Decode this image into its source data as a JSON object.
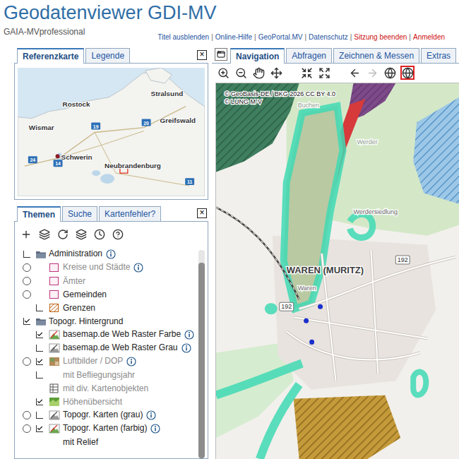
{
  "header": {
    "title": "Geodatenviewer GDI-MV",
    "subtitle": "GAIA-MVprofessional",
    "separator": "|",
    "links": [
      {
        "label": "Titel ausblenden",
        "alert": false
      },
      {
        "label": "Online-Hilfe",
        "alert": false
      },
      {
        "label": "GeoPortal.MV",
        "alert": false
      },
      {
        "label": "Datenschutz",
        "alert": false
      },
      {
        "label": "Sitzung beenden",
        "alert": true
      },
      {
        "label": "Anmelden",
        "alert": true
      }
    ]
  },
  "reference_panel": {
    "tabs": [
      {
        "label": "Referenzkarte",
        "selected": true
      },
      {
        "label": "Legende",
        "selected": false
      }
    ],
    "close": "×",
    "places": [
      {
        "name": "Stralsund",
        "kind": "city"
      },
      {
        "name": "Rostock",
        "kind": "city"
      },
      {
        "name": "Greifswald",
        "kind": "city"
      },
      {
        "name": "Wismar",
        "kind": "city"
      },
      {
        "name": "Schwerin",
        "kind": "capital"
      },
      {
        "name": "Neubrandenburg",
        "kind": "city"
      },
      {
        "name": "19",
        "kind": "road"
      },
      {
        "name": "20",
        "kind": "road"
      },
      {
        "name": "24",
        "kind": "road"
      },
      {
        "name": "14",
        "kind": "road"
      },
      {
        "name": "11",
        "kind": "road"
      }
    ]
  },
  "themes_panel": {
    "tabs": [
      {
        "label": "Themen",
        "selected": true
      },
      {
        "label": "Suche",
        "selected": false
      },
      {
        "label": "Kartenfehler?",
        "selected": false
      }
    ],
    "close": "×",
    "layers": [
      {
        "label": "Administration",
        "kind": "folder",
        "radio": false,
        "selected": false,
        "checkbox": true,
        "checked": false,
        "muted": false,
        "info": true
      },
      {
        "label": "Kreise und Städte",
        "kind": "polygon",
        "radio": true,
        "selected": false,
        "checkbox": false,
        "checked": false,
        "muted": true,
        "info": true
      },
      {
        "label": "Ämter",
        "kind": "polygon",
        "radio": true,
        "selected": false,
        "checkbox": false,
        "checked": false,
        "muted": true,
        "info": false
      },
      {
        "label": "Gemeinden",
        "kind": "polygon",
        "radio": true,
        "selected": false,
        "checkbox": false,
        "checked": false,
        "muted": false,
        "info": false
      },
      {
        "label": "Grenzen",
        "kind": "hatch",
        "radio": false,
        "selected": false,
        "checkbox": true,
        "checked": false,
        "muted": false,
        "info": false
      },
      {
        "label": "Topogr. Hintergrund",
        "kind": "folder",
        "radio": false,
        "selected": false,
        "checkbox": true,
        "checked": true,
        "muted": false,
        "info": false
      },
      {
        "label": "basemap.de Web Raster Farbe",
        "kind": "raster",
        "radio": false,
        "selected": false,
        "checkbox": true,
        "checked": true,
        "muted": false,
        "info": true
      },
      {
        "label": "basemap.de Web Raster Grau",
        "kind": "raster-grey",
        "radio": false,
        "selected": false,
        "checkbox": true,
        "checked": false,
        "muted": false,
        "info": true
      },
      {
        "label": "Luftbilder / DOP",
        "kind": "photo",
        "radio": true,
        "selected": false,
        "checkbox": true,
        "checked": true,
        "muted": true,
        "info": true
      },
      {
        "label": "mit Befliegungsjahr",
        "kind": "option",
        "radio": false,
        "selected": false,
        "checkbox": true,
        "checked": false,
        "muted": true,
        "info": false
      },
      {
        "label": "mit div. Kartenobjekten",
        "kind": "table",
        "radio": false,
        "selected": false,
        "checkbox": false,
        "checked": false,
        "muted": true,
        "info": false
      },
      {
        "label": "Höhenübersicht",
        "kind": "elevation",
        "radio": false,
        "selected": false,
        "checkbox": true,
        "checked": true,
        "muted": true,
        "info": false
      },
      {
        "label": "Topogr. Karten (grau)",
        "kind": "raster-grey",
        "radio": true,
        "selected": false,
        "checkbox": true,
        "checked": false,
        "muted": false,
        "info": true
      },
      {
        "label": "Topogr. Karten (farbig)",
        "kind": "raster",
        "radio": true,
        "selected": false,
        "checkbox": true,
        "checked": true,
        "muted": false,
        "info": true
      },
      {
        "label": "mit Relief",
        "kind": "option",
        "radio": false,
        "selected": false,
        "checkbox": false,
        "checked": false,
        "muted": false,
        "info": false
      }
    ]
  },
  "map_panel": {
    "tabs": [
      {
        "label": "Navigation",
        "selected": true
      },
      {
        "label": "Abfragen",
        "selected": false
      },
      {
        "label": "Zeichnen & Messen",
        "selected": false
      },
      {
        "label": "Extras",
        "selected": false
      }
    ],
    "tools": [
      {
        "kind": "zoom-in",
        "disabled": false,
        "selected": false
      },
      {
        "kind": "zoom-out",
        "disabled": false,
        "selected": false
      },
      {
        "kind": "pan",
        "disabled": false,
        "selected": false
      },
      {
        "kind": "move",
        "disabled": false,
        "selected": false
      },
      {
        "kind": "shrink",
        "disabled": false,
        "selected": false
      },
      {
        "kind": "expand",
        "disabled": false,
        "selected": false
      },
      {
        "kind": "back",
        "disabled": false,
        "selected": false
      },
      {
        "kind": "forward",
        "disabled": true,
        "selected": false
      },
      {
        "kind": "globe",
        "disabled": false,
        "selected": false
      },
      {
        "kind": "globe",
        "disabled": false,
        "selected": true
      }
    ],
    "map": {
      "attribution": [
        "© GeoBasis-DE / BKG 2026 CC BY 4.0",
        "© LUNG M-V"
      ],
      "labels": [
        {
          "text": "WAREN (MURITZ)",
          "kind": "town"
        },
        {
          "text": "Waren",
          "kind": "place"
        },
        {
          "text": "Werdersiedlung",
          "kind": "place"
        },
        {
          "text": "Werder",
          "kind": "faint"
        },
        {
          "text": "Buchen",
          "kind": "faint"
        },
        {
          "text": "192",
          "kind": "road"
        },
        {
          "text": "192",
          "kind": "road"
        }
      ]
    }
  }
}
